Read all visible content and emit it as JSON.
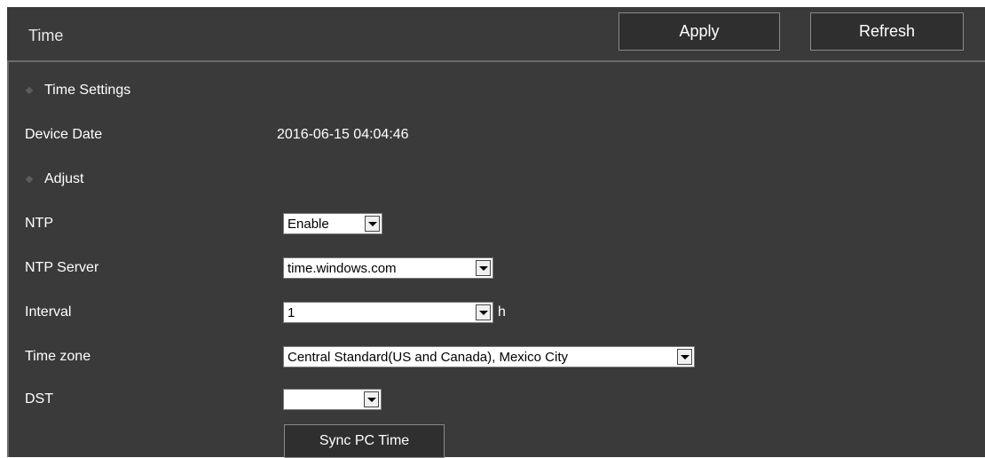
{
  "header": {
    "title": "Time",
    "apply_label": "Apply",
    "refresh_label": "Refresh"
  },
  "sections": {
    "time_settings": "Time Settings",
    "adjust": "Adjust"
  },
  "device_date": {
    "label": "Device Date",
    "value": "2016-06-15 04:04:46"
  },
  "fields": {
    "ntp": {
      "label": "NTP",
      "value": "Enable"
    },
    "ntp_server": {
      "label": "NTP Server",
      "value": "time.windows.com"
    },
    "interval": {
      "label": "Interval",
      "value": "1",
      "unit": "h"
    },
    "time_zone": {
      "label": "Time zone",
      "value": "Central Standard(US and Canada), Mexico City"
    },
    "dst": {
      "label": "DST",
      "value": ""
    }
  },
  "sync_label": "Sync PC Time",
  "colors": {
    "panel_bg": "#3a3a3a",
    "button_bg": "#2f2f2f",
    "text": "#ffffff"
  },
  "icons": {
    "section_bullet": "diamond-icon",
    "dropdown": "chevron-down-icon"
  }
}
